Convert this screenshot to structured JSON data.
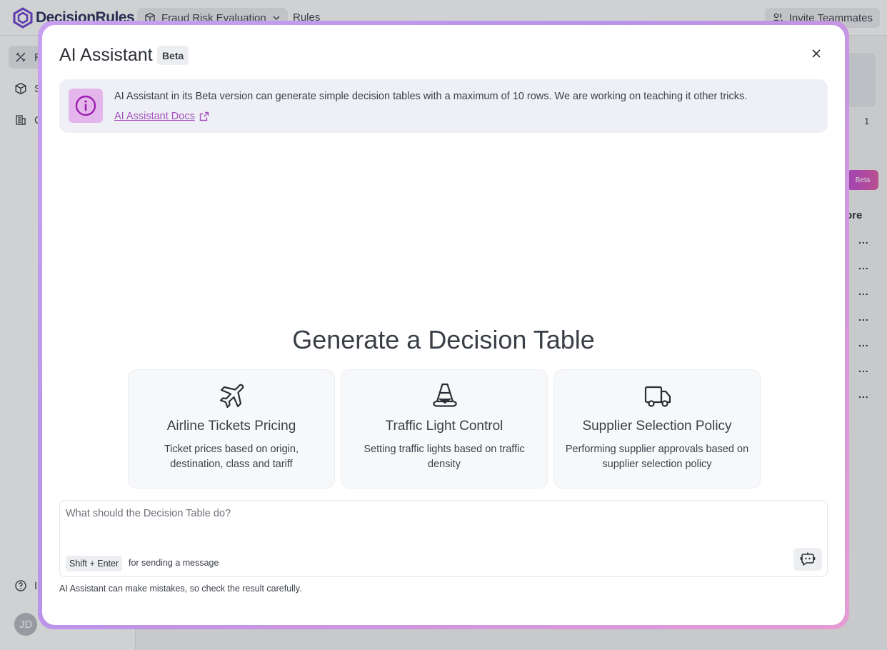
{
  "background": {
    "brand": "DecisionRules",
    "breadcrumb_space": "Fraud Risk Evaluation",
    "breadcrumb_section": "Rules",
    "invite_label": "Invite Teammates",
    "sidebar_items": [
      "R",
      "S",
      "C",
      "I"
    ],
    "avatar_initials": "JD",
    "count_badge": "1",
    "beta_tag": "Beta",
    "column_fragment": "ore",
    "ellipsis": "..."
  },
  "modal": {
    "title": "AI Assistant",
    "badge": "Beta",
    "info": {
      "text": "AI Assistant in its Beta version can generate simple decision tables with a maximum of 10 rows. We are working on teaching it other tricks.",
      "link_label": "AI Assistant Docs"
    },
    "heading": "Generate a Decision Table",
    "templates": [
      {
        "icon": "airplane-icon",
        "title": "Airline Tickets Pricing",
        "description": "Ticket prices based on origin, destination, class and tariff"
      },
      {
        "icon": "traffic-cone-icon",
        "title": "Traffic Light Control",
        "description": "Setting traffic lights based on traffic density"
      },
      {
        "icon": "truck-icon",
        "title": "Supplier Selection Policy",
        "description": "Performing supplier approvals based on supplier selection policy"
      }
    ],
    "input": {
      "placeholder": "What should the Decision Table do?",
      "value": "",
      "shortcut": "Shift + Enter",
      "shortcut_hint": "for sending a message"
    },
    "disclaimer": "AI Assistant can make mistakes, so check the result carefully."
  },
  "colors": {
    "accent": "#a44fc0",
    "info_icon_bg": "#e4b6ec",
    "modal_border_start": "#c9a0f0",
    "modal_border_end": "#e79bd4"
  }
}
